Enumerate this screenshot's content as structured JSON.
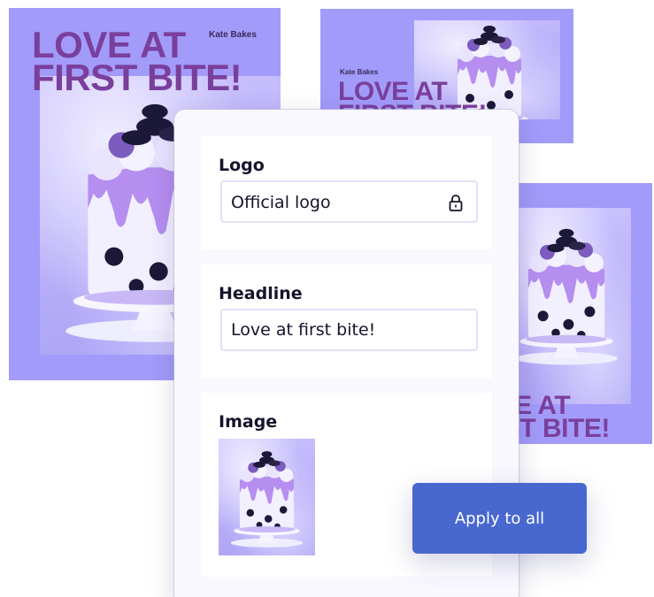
{
  "cards": {
    "left": {
      "brand": "Kate Bakes",
      "headline": "LOVE AT\nFIRST BITE!"
    },
    "top_right": {
      "brand": "Kate Bakes",
      "headline": "LOVE AT\nFIRST BITE!"
    },
    "right": {
      "headline": "LOVE AT\nFIRST BITE!"
    }
  },
  "panel": {
    "logo": {
      "title": "Logo",
      "value": "Official logo",
      "icon": "lock-icon"
    },
    "headline": {
      "title": "Headline",
      "value": "Love at first bite!"
    },
    "image": {
      "title": "Image"
    }
  },
  "apply_button": {
    "label": "Apply to all"
  },
  "colors": {
    "card_bg": "#a29bfa",
    "headline": "#7a3f9c",
    "button": "#4867cf",
    "field_border": "#e6def8"
  }
}
